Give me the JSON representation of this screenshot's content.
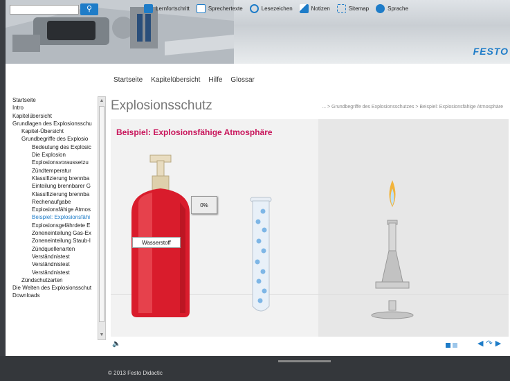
{
  "header": {
    "search_placeholder": "",
    "nav": [
      {
        "label": "Lernfortschritt",
        "icon": "progress-icon",
        "color": "#1e7cc8"
      },
      {
        "label": "Sprechertexte",
        "icon": "document-icon",
        "color": "#1e7cc8"
      },
      {
        "label": "Lesezeichen",
        "icon": "bookmark-icon",
        "color": "#1e7cc8"
      },
      {
        "label": "Notizen",
        "icon": "pencil-icon",
        "color": "#1e7cc8"
      },
      {
        "label": "Sitemap",
        "icon": "sitemap-icon",
        "color": "#1e7cc8"
      },
      {
        "label": "Sprache",
        "icon": "globe-icon",
        "color": "#1e7cc8"
      }
    ],
    "brand": "FESTO"
  },
  "mainnav": [
    "Startseite",
    "Kapitelübersicht",
    "Hilfe",
    "Glossar"
  ],
  "sidebar": [
    {
      "label": "Startseite",
      "level": 1
    },
    {
      "label": "Intro",
      "level": 1
    },
    {
      "label": "Kapitelübersicht",
      "level": 1
    },
    {
      "label": "Grundlagen des Explosionsschu",
      "level": 1
    },
    {
      "label": "Kapitel-Übersicht",
      "level": 2
    },
    {
      "label": "Grundbegriffe des Explosio",
      "level": 2
    },
    {
      "label": "Bedeutung des Explosic",
      "level": 3
    },
    {
      "label": "Die Explosion",
      "level": 3
    },
    {
      "label": "Explosionsvoraussetzu",
      "level": 3
    },
    {
      "label": "Zündtemperatur",
      "level": 3
    },
    {
      "label": "Klassifizierung brennba",
      "level": 3
    },
    {
      "label": "Einteilung brennbarer G",
      "level": 3
    },
    {
      "label": "Klassifizierung brennba",
      "level": 3
    },
    {
      "label": "Rechenaufgabe",
      "level": 3
    },
    {
      "label": "Explosionsfähige Atmos",
      "level": 3
    },
    {
      "label": "Beispiel: Explosionsfähi",
      "level": 3,
      "active": true
    },
    {
      "label": "Explosionsgefährdete E",
      "level": 3
    },
    {
      "label": "Zoneneinteilung Gas-Ex",
      "level": 3
    },
    {
      "label": "Zoneneinteilung Staub-I",
      "level": 3
    },
    {
      "label": "Zündquellenarten",
      "level": 3
    },
    {
      "label": "Verständnistest",
      "level": 3
    },
    {
      "label": "Verständnistest",
      "level": 3
    },
    {
      "label": "Verständnistest",
      "level": 3
    },
    {
      "label": "Zündschutzarten",
      "level": 2
    },
    {
      "label": "Die Welten des Explosionsschut",
      "level": 1
    },
    {
      "label": "Downloads",
      "level": 1
    }
  ],
  "content": {
    "title": "Explosionsschutz",
    "breadcrumb": "... > Grundbegriffe des Explosionsschutzes > Beispiel: Explosionsfähige Atmosphäre",
    "scene_title": "Beispiel: Explosionsfähige Atmosphäre",
    "percent": "0%",
    "gas_label": "Wasserstoff"
  },
  "footer": {
    "copyright": "© 2013 Festo Didactic"
  },
  "colors": {
    "accent": "#1e7cc8",
    "title_red": "#c8155b",
    "cylinder_red": "#d91c2c"
  }
}
